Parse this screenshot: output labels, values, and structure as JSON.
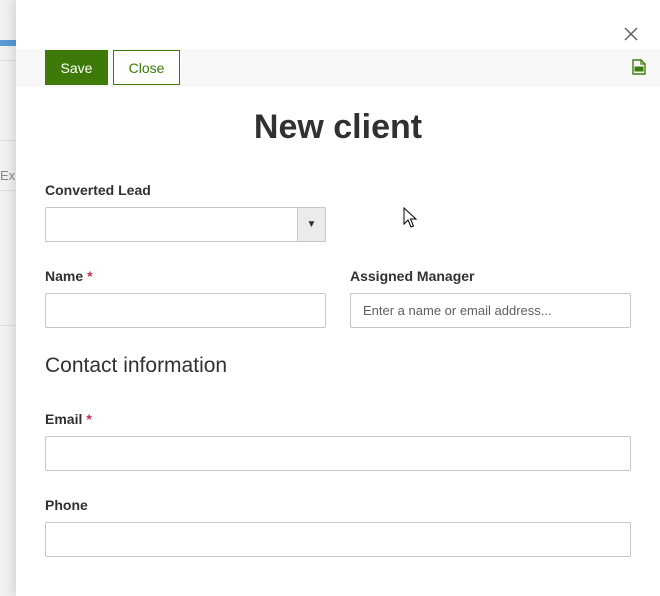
{
  "background": {
    "side_text": "Exp"
  },
  "toolbar": {
    "save_label": "Save",
    "close_label": "Close"
  },
  "form": {
    "title": "New client",
    "converted_lead": {
      "label": "Converted Lead",
      "value": ""
    },
    "name": {
      "label": "Name",
      "required_mark": "*",
      "value": ""
    },
    "assigned_manager": {
      "label": "Assigned Manager",
      "placeholder": "Enter a name or email address...",
      "value": ""
    },
    "contact_section_title": "Contact information",
    "email": {
      "label": "Email",
      "required_mark": "*",
      "value": ""
    },
    "phone": {
      "label": "Phone",
      "value": ""
    }
  },
  "colors": {
    "accent": "#3e7a0a",
    "required": "#c4314b"
  }
}
